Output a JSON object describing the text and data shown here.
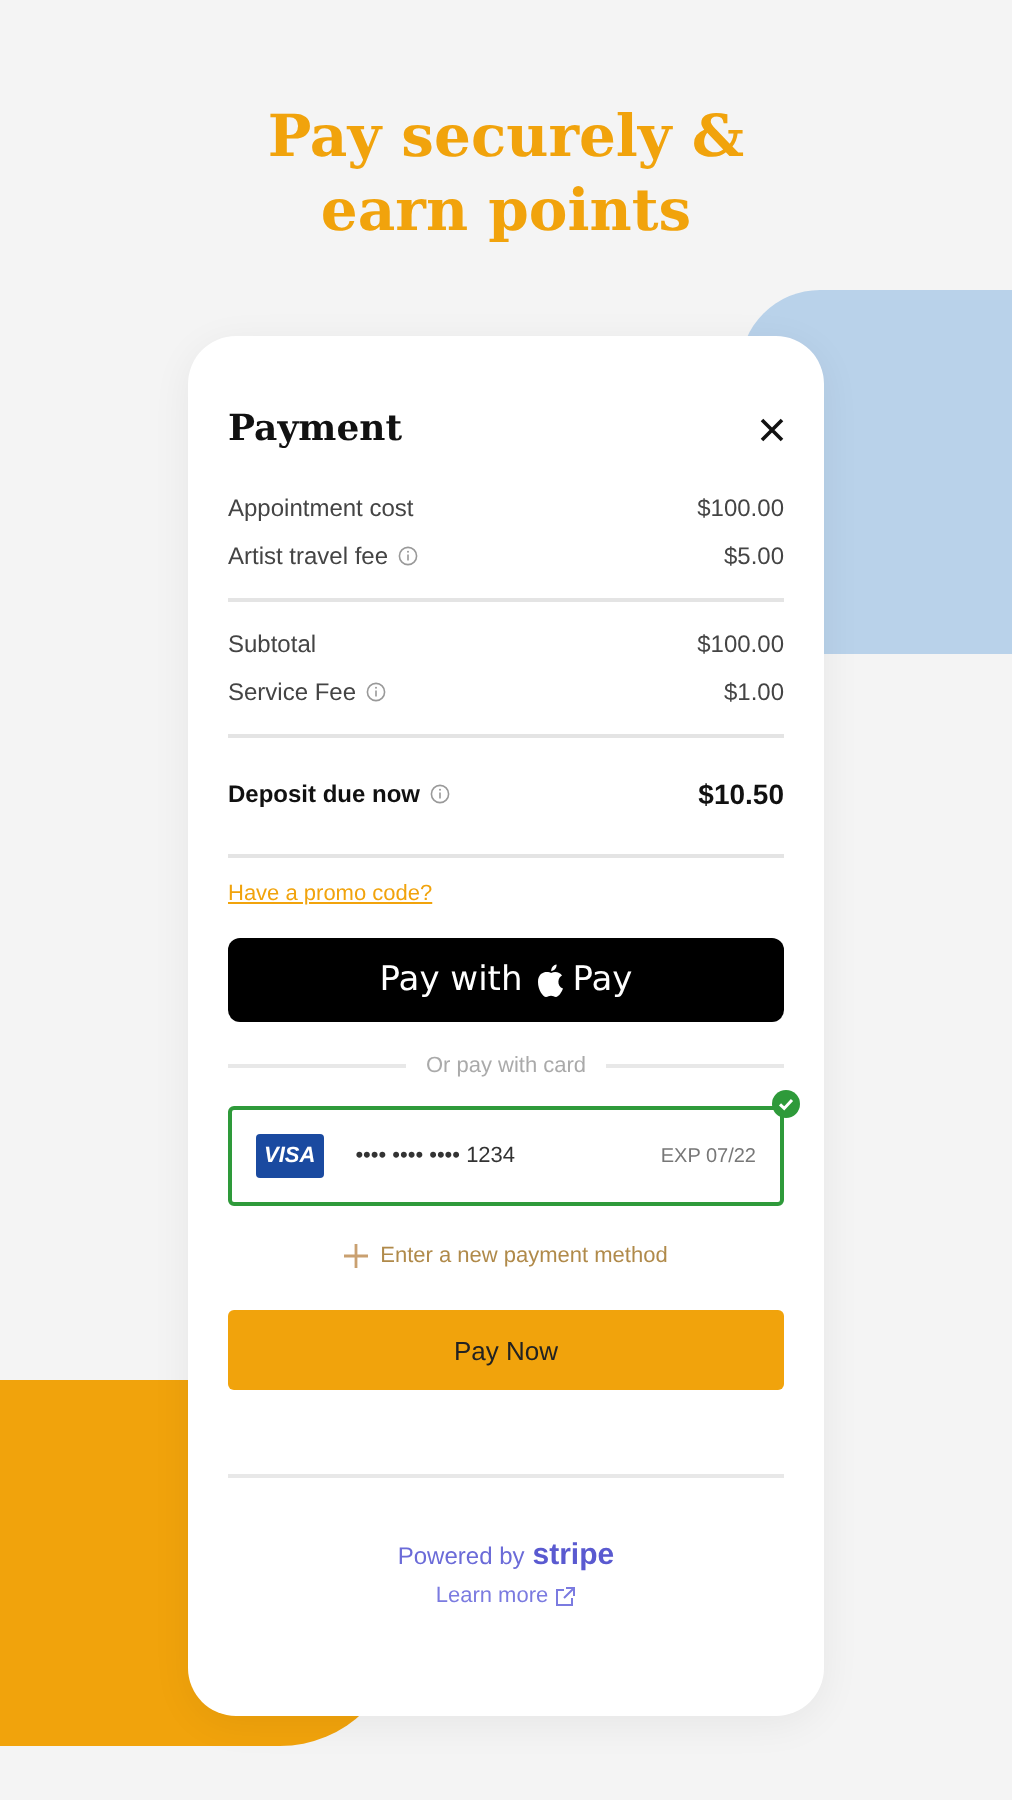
{
  "headline": "Pay securely & earn points",
  "payment": {
    "title": "Payment",
    "groups": [
      {
        "rows": [
          {
            "label": "Appointment cost",
            "value": "$100.00",
            "info": false
          },
          {
            "label": "Artist travel fee",
            "value": "$5.00",
            "info": true
          }
        ]
      },
      {
        "rows": [
          {
            "label": "Subtotal",
            "value": "$100.00",
            "info": false
          },
          {
            "label": "Service Fee",
            "value": "$1.00",
            "info": true
          }
        ]
      }
    ],
    "total": {
      "label": "Deposit due now",
      "value": "$10.50",
      "info": true
    },
    "promo_link": "Have a promo code?",
    "apple_pay": {
      "before": "Pay with",
      "after": "Pay"
    },
    "divider_text": "Or pay with card",
    "cards": [
      {
        "brand": "VISA",
        "number": "•••• •••• •••• 1234",
        "expiry": "EXP 07/22",
        "selected": true
      }
    ],
    "add_method": "Enter a new payment method",
    "pay_button": "Pay Now",
    "powered": {
      "text": "Powered by",
      "brand": "stripe"
    },
    "learn_more": "Learn more"
  }
}
